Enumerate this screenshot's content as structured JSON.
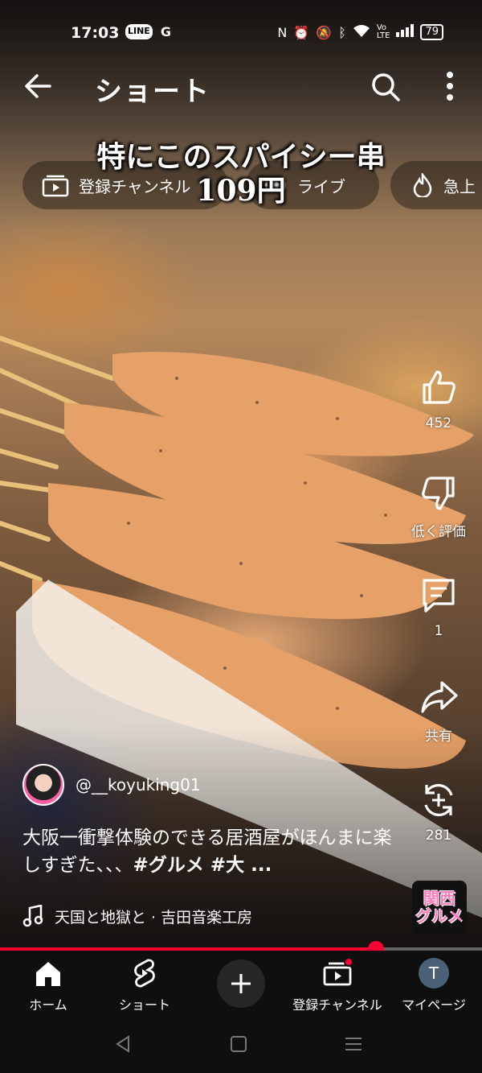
{
  "status_bar": {
    "time": "17:03",
    "left_icons": [
      "LINE",
      "G"
    ],
    "right_icons": [
      "nfc-icon",
      "alarm-icon",
      "mute-icon",
      "bluetooth-icon",
      "wifi-icon",
      "volte-icon",
      "signal-icon"
    ],
    "battery": "79"
  },
  "app_bar": {
    "title": "ショート"
  },
  "chips": [
    {
      "label": "登録チャンネル",
      "icon": "subscriptions-icon"
    },
    {
      "label": "ライブ",
      "icon": "live-icon"
    },
    {
      "label": "急上",
      "icon": "trending-icon"
    }
  ],
  "overlay_caption": {
    "line1": "特にこのスパイシー串",
    "line2": "109円"
  },
  "actions": {
    "like_count": "452",
    "dislike_label": "低く評価",
    "comment_count": "1",
    "share_label": "共有",
    "remix_count": "281"
  },
  "channel": {
    "handle": "@__koyuking01"
  },
  "description": {
    "text": "大阪一衝撃体験のできる居酒屋がほんまに楽しすぎた、、、",
    "hashtags": "#グルメ #大 ..."
  },
  "music": {
    "track": "天国と地獄と · 吉田音楽工房"
  },
  "sound_thumb": {
    "line1": "関西",
    "line2": "グルメ"
  },
  "progress": {
    "fraction": 0.78
  },
  "bottom_nav": {
    "home": "ホーム",
    "shorts": "ショート",
    "subscriptions": "登録チャンネル",
    "mypage": "マイページ",
    "avatar_letter": "T"
  },
  "colors": {
    "accent": "#ff0033",
    "nav_bg": "#0f0f0f"
  }
}
